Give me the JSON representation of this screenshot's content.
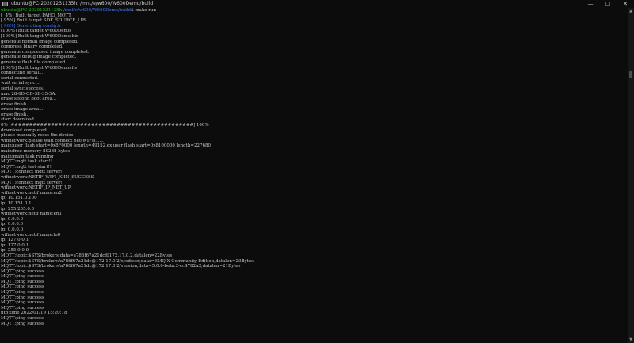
{
  "window": {
    "title": "ubuntu@PC-20201231135h: /mnt/e/w600/W600Demo/build",
    "controls": {
      "minimize": "—",
      "maximize": "☐",
      "close": "✕"
    }
  },
  "prompt": {
    "user": "ubuntu@PC-20201231135h",
    "path": ":/mnt/e/w600/W600Demo/build",
    "rest": "$ make run"
  },
  "lines": [
    "[  4%] Built target PAHO_MQTT",
    "[ 95%] Built target SDK_SOURCE_LIB",
    "[ 96%] Generating config.h",
    "[100%] Built target W600Demo",
    "[100%] Built target W600Demo.bin",
    "generate normal image completed.",
    "compress binary completed.",
    "generate compressed image completed.",
    "generate debug image completed.",
    "generate flash file completed.",
    "[100%] Built target W600Demo.fls",
    "connecting serial...",
    "serial connected.",
    "wait serial sync...",
    "serial sync success.",
    "mac 28-6D-CD-3E-35-5A.",
    "erase second boot area...",
    "erase finish.",
    "erase image area...",
    "erase finish.",
    "start download.",
    "0% [##################################################] 100%",
    "download completed.",
    "please manually reset the device.",
    "wifinetwork:please wait connect net(WIFI)......",
    "main:user flash start=0x8F0000 length=49152,ex user flash start=0x8100000 length=227680",
    "main:free memory 89288 bytes",
    "main:main task running",
    "MQTT:mqtt task start!!",
    "MQTT:mqtt test start!!",
    "MQTT:connect mqtt server!",
    "wifinetwork:NETIF_WIFI_JOIN_SUCCESS",
    "MQTT:connect mqtt server!",
    "wifinetwork:NETIF_IP_NET_UP",
    "wifinetwork:netif name:en2",
    "ip: 10.151.0.100",
    "ip: 10.151.0.1",
    "ip: 255.255.0.0",
    "wifinetwork:netif name:en1",
    "ip: 0.0.0.0",
    "ip: 0.0.0.0",
    "ip: 0.0.0.0",
    "wifinetwork:netif name:lo0",
    "ip: 127.0.0.1",
    "ip: 127.0.0.1",
    "ip: 255.0.0.0",
    "MQTT:topic:$SYS/brokers,data=a786f67a21dc@172.17.0.2,datalen=22Bytes",
    "MQTT:topic:$SYS/brokers/a786f67a21dc@172.17.0.2/sysdescr,data=EMQ X Community Edition,datalen=23Bytes",
    "MQTT:topic:$SYS/brokers/a786f67a21dc@172.17.0.2/version,data=5.0.0-beta.3-cc4782a3,datalen=21Bytes",
    "MQTT:ping success",
    "MQTT:ping success",
    "MQTT:ping success",
    "MQTT:ping success",
    "MQTT:ping success",
    "MQTT:ping success",
    "MQTT:ping success",
    "MQTT:ping success",
    "ntp:time 2022/01/19 15:20:18",
    "MQTT:ping success",
    "MQTT:ping success"
  ]
}
